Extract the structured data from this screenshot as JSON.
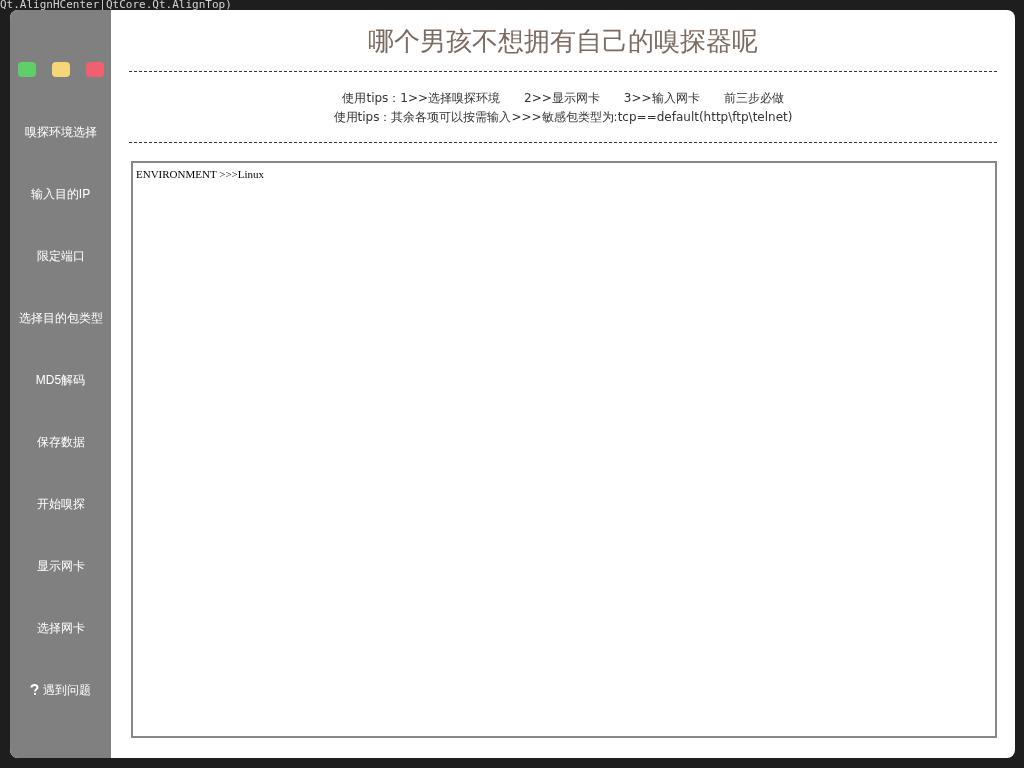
{
  "background_editor": {
    "line": "Qt.AlignHCenter|QtCore.Qt.AlignTop)"
  },
  "window": {
    "title": "哪个男孩不想拥有自己的嗅探器呢"
  },
  "window_controls": [
    {
      "color": "#5fd068"
    },
    {
      "color": "#f5d77a"
    },
    {
      "color": "#f0606e"
    }
  ],
  "sidebar": {
    "items": [
      {
        "label": "嗅探环境选择"
      },
      {
        "label": "输入目的IP"
      },
      {
        "label": "限定端口"
      },
      {
        "label": "选择目的包类型"
      },
      {
        "label": "MD5解码"
      },
      {
        "label": "保存数据"
      },
      {
        "label": "开始嗅探"
      },
      {
        "label": "显示网卡"
      },
      {
        "label": "选择网卡"
      },
      {
        "label": "遇到问题",
        "kind": "help"
      }
    ]
  },
  "tips": [
    "使用tips：1>>选择嗅探环境　　2>>显示网卡　　3>>输入网卡　　前三步必做",
    "使用tips：其余各项可以按需输入>>>敏感包类型为:tcp==default(http\\ftp\\telnet)"
  ],
  "output": {
    "text": "ENVIRONMENT >>>Linux"
  }
}
